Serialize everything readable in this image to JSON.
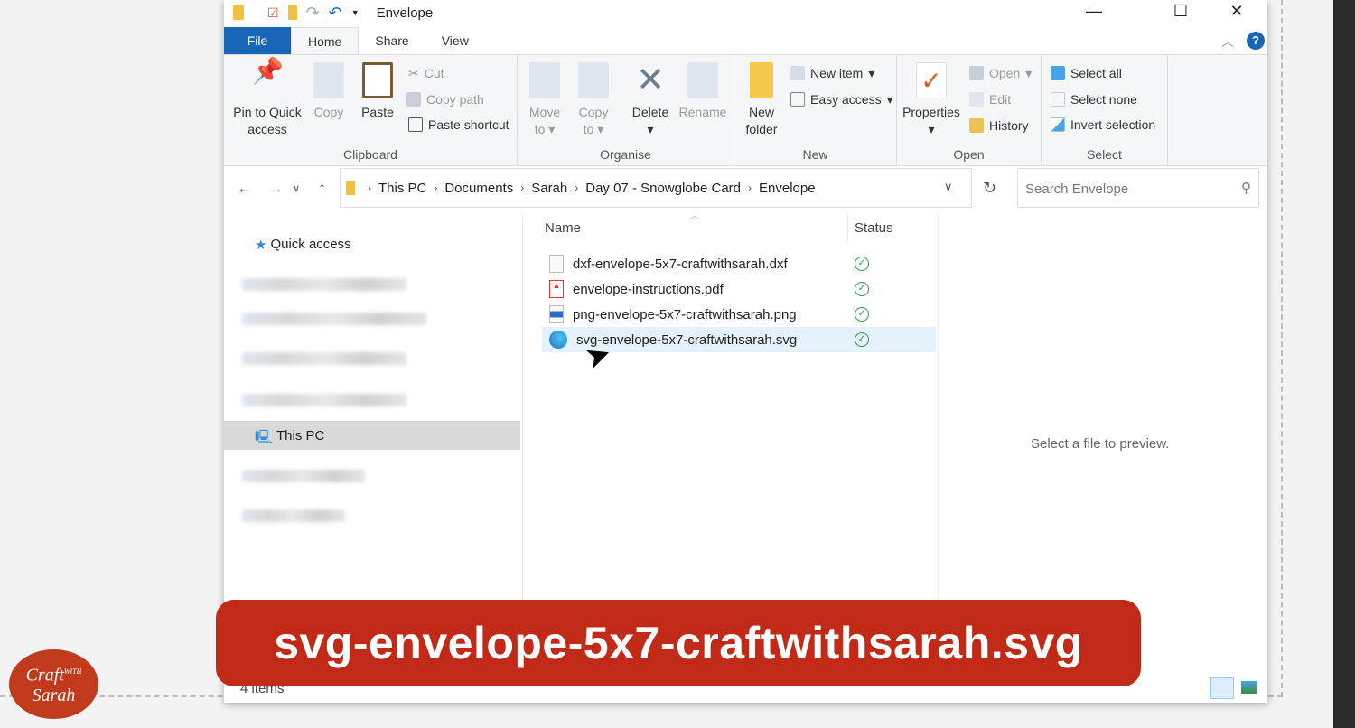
{
  "window": {
    "title": "Envelope",
    "minimize_icon": "minimize-icon",
    "maximize_icon": "maximize-icon",
    "close_icon": "close-icon"
  },
  "tabs": [
    "File",
    "Home",
    "Share",
    "View"
  ],
  "ribbon": {
    "clipboard": {
      "label": "Clipboard",
      "pin": "Pin to Quick access",
      "copy": "Copy",
      "paste": "Paste",
      "cut": "Cut",
      "copy_path": "Copy path",
      "paste_shortcut": "Paste shortcut"
    },
    "organise": {
      "label": "Organise",
      "move_to": "Move to",
      "copy_to": "Copy to",
      "delete": "Delete",
      "rename": "Rename"
    },
    "new": {
      "label": "New",
      "new_folder": "New folder",
      "new_item": "New item",
      "easy_access": "Easy access"
    },
    "open": {
      "label": "Open",
      "properties": "Properties",
      "open": "Open",
      "edit": "Edit",
      "history": "History"
    },
    "select": {
      "label": "Select",
      "select_all": "Select all",
      "select_none": "Select none",
      "invert": "Invert selection"
    }
  },
  "address": {
    "crumbs": [
      "This PC",
      "Documents",
      "Sarah",
      "Day 07 - Snowglobe Card",
      "Envelope"
    ],
    "search_placeholder": "Search Envelope"
  },
  "sidebar": {
    "quick_access": "Quick access",
    "this_pc": "This PC"
  },
  "files": {
    "columns": [
      "Name",
      "Status"
    ],
    "rows": [
      {
        "name": "dxf-envelope-5x7-craftwithsarah.dxf",
        "type": "file"
      },
      {
        "name": "envelope-instructions.pdf",
        "type": "pdf"
      },
      {
        "name": "png-envelope-5x7-craftwithsarah.png",
        "type": "image"
      },
      {
        "name": "svg-envelope-5x7-craftwithsarah.svg",
        "type": "edge",
        "selected": true
      }
    ]
  },
  "preview": "Select a file to preview.",
  "status": "4 items",
  "banner": "svg-envelope-5x7-craftwithsarah.svg",
  "logo": "Craft with Sarah",
  "colors": {
    "accent": "#1965b7",
    "banner": "#c12a17",
    "status_ok": "#2a9d4a",
    "selected": "#e5f1fb"
  }
}
